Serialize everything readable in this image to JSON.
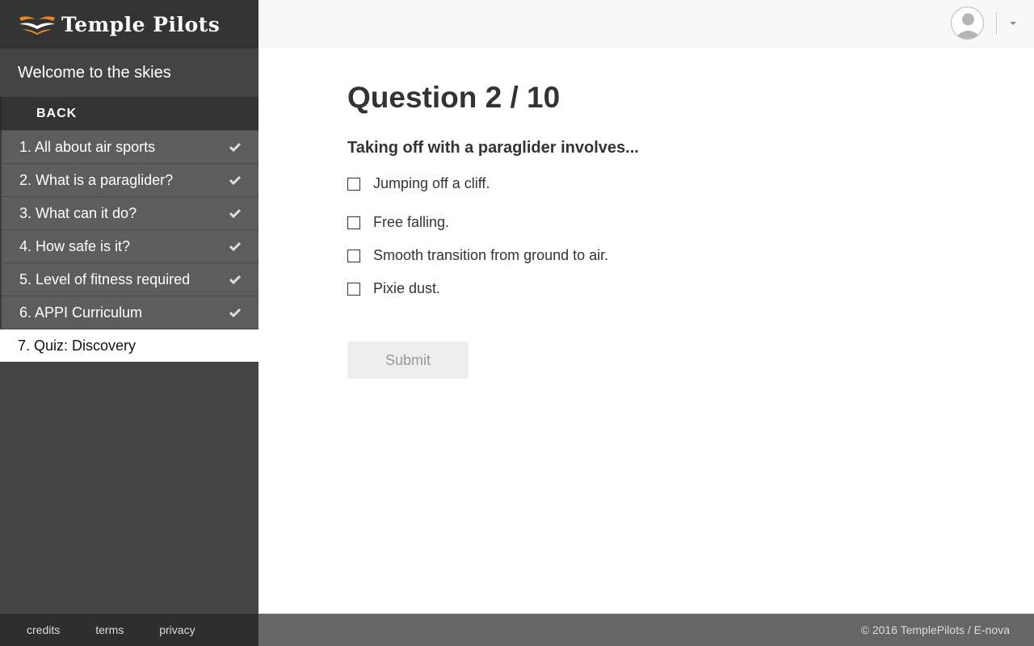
{
  "brand": {
    "name": "Temple Pilots",
    "icon": "wing-logo-icon",
    "accent": "#e8852a"
  },
  "sidebar": {
    "welcome": "Welcome to the skies",
    "back_label": "BACK",
    "items": [
      {
        "label": "1. All about air sports",
        "completed": true
      },
      {
        "label": "2. What is a paraglider?",
        "completed": true
      },
      {
        "label": "3. What can it do?",
        "completed": true
      },
      {
        "label": "4. How safe is it?",
        "completed": true
      },
      {
        "label": "5. Level of fitness required",
        "completed": true
      },
      {
        "label": "6. APPI Curriculum",
        "completed": true
      },
      {
        "label": "7. Quiz: Discovery",
        "completed": false,
        "active": true
      }
    ],
    "footer_links": [
      "credits",
      "terms",
      "privacy"
    ]
  },
  "header": {
    "avatar_icon": "user-avatar-icon",
    "menu_icon": "caret-down-icon"
  },
  "quiz": {
    "title": "Question 2 / 10",
    "prompt": "Taking off with a paraglider involves...",
    "options": [
      {
        "label": "Jumping off a cliff.",
        "checked": false
      },
      {
        "label": "Free falling.",
        "checked": false
      },
      {
        "label": "Smooth transition from ground to air.",
        "checked": false
      },
      {
        "label": "Pixie dust.",
        "checked": false
      }
    ],
    "submit_label": "Submit"
  },
  "footer": {
    "copyright": "© 2016 TemplePilots / E-nova"
  }
}
